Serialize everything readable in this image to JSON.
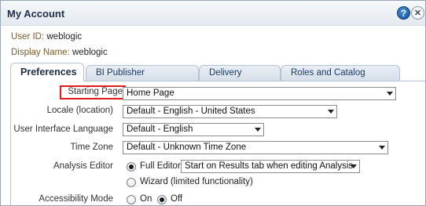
{
  "dialog": {
    "title": "My Account",
    "help_icon": "question-mark-icon",
    "close_icon": "x-icon"
  },
  "account": {
    "user_id_label": "User ID:",
    "user_id_value": "weblogic",
    "display_name_label": "Display Name:",
    "display_name_value": "weblogic"
  },
  "tabs": [
    {
      "label": "Preferences",
      "active": true
    },
    {
      "label": "BI Publisher Preferences",
      "active": false
    },
    {
      "label": "Delivery Options",
      "active": false
    },
    {
      "label": "Roles and Catalog Groups",
      "active": false
    }
  ],
  "preferences": {
    "starting_page": {
      "label": "Starting Page",
      "value": "Home Page"
    },
    "locale": {
      "label": "Locale (location)",
      "value": "Default - English - United States"
    },
    "ui_language": {
      "label": "User Interface Language",
      "value": "Default - English"
    },
    "time_zone": {
      "label": "Time Zone",
      "value": "Default - Unknown Time Zone"
    },
    "analysis_editor": {
      "label": "Analysis Editor",
      "full_editor_label": "Full Editor",
      "full_editor_option": "Start on Results tab when editing Analysis",
      "wizard_label": "Wizard (limited functionality)",
      "selected": "full"
    },
    "accessibility_mode": {
      "label": "Accessibility Mode",
      "on_label": "On",
      "off_label": "Off",
      "selected": "off"
    }
  },
  "colors": {
    "highlight_border": "#e01b1b",
    "title_text": "#1f2f48",
    "tab_text": "#1f3a66"
  }
}
